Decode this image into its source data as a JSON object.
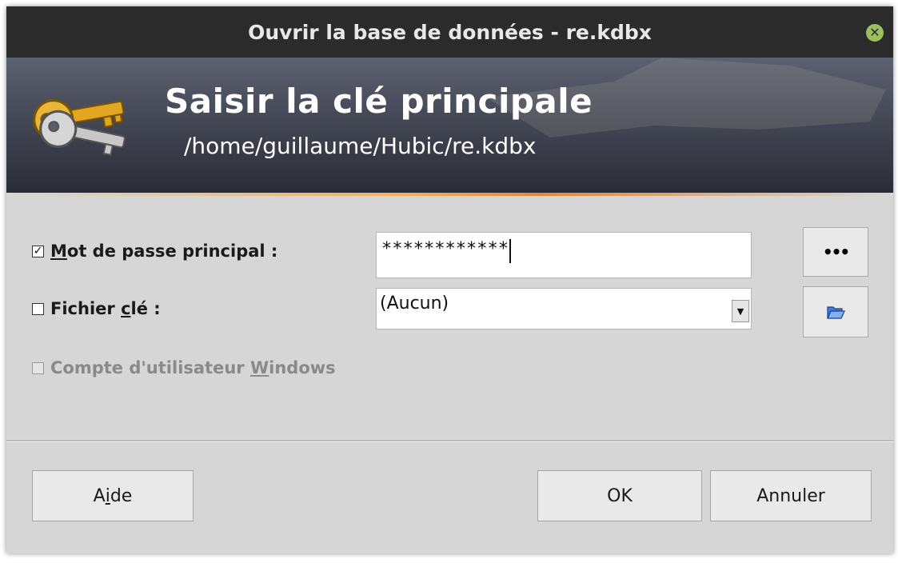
{
  "window": {
    "title": "Ouvrir la base de données - re.kdbx"
  },
  "banner": {
    "title": "Saisir la clé principale",
    "path": "/home/guillaume/Hubic/re.kdbx"
  },
  "form": {
    "master_password": {
      "checked": true,
      "label_pre": "",
      "label_mnemonic": "M",
      "label_post": "ot de passe principal :",
      "value": "************"
    },
    "key_file": {
      "checked": false,
      "label_pre": "Fichier ",
      "label_mnemonic": "c",
      "label_post": "lé :",
      "value": "(Aucun)"
    },
    "windows_account": {
      "checked": false,
      "label_pre": "Compte d'utilisateur ",
      "label_mnemonic": "W",
      "label_post": "indows"
    },
    "reveal_button": {
      "label": "•••"
    }
  },
  "buttons": {
    "help_pre": "A",
    "help_mnemonic": "i",
    "help_post": "de",
    "ok": "OK",
    "cancel": "Annuler"
  },
  "colors": {
    "titlebar": "#2b2b2b",
    "close_button": "#9bbf5c",
    "dialog_bg": "#d6d6d6",
    "banner_accent": "#e08a3a"
  }
}
